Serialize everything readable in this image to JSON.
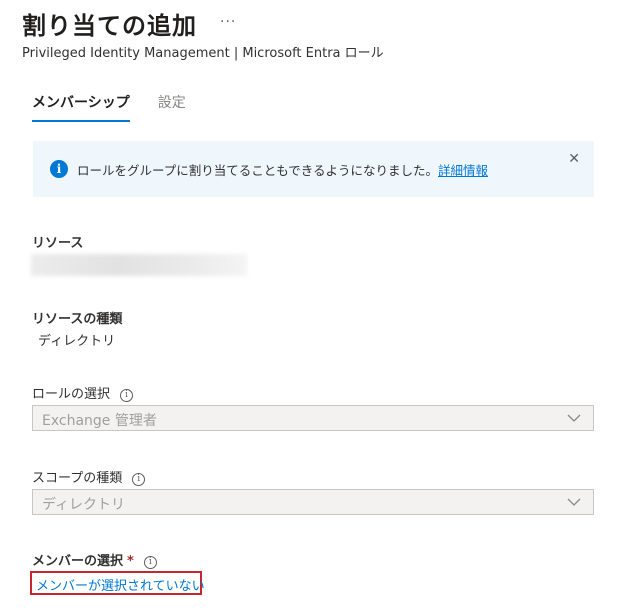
{
  "header": {
    "title": "割り当ての追加",
    "more_glyph": "···",
    "subtitle": "Privileged Identity Management | Microsoft Entra ロール"
  },
  "tabs": [
    {
      "label": "メンバーシップ",
      "active": true
    },
    {
      "label": "設定",
      "active": false
    }
  ],
  "banner": {
    "icon": "info-icon",
    "text": "ロールをグループに割り当てることもできるようになりました。",
    "link_text": "詳細情報",
    "close_glyph": "✕"
  },
  "resource": {
    "label": "リソース",
    "value_hidden": true
  },
  "resource_type": {
    "label": "リソースの種類",
    "value": "ディレクトリ"
  },
  "role_select": {
    "label": "ロールの選択",
    "value": "Exchange 管理者",
    "disabled": true
  },
  "scope_type": {
    "label": "スコープの種類",
    "value": "ディレクトリ",
    "disabled": true
  },
  "member_select": {
    "label": "メンバーの選択",
    "required_mark": "*",
    "link_text": "メンバーが選択されていない"
  },
  "info_glyph": "i",
  "colors": {
    "accent": "#0078d4",
    "banner_bg": "#eff6fc",
    "highlight_border": "#c4262e",
    "required": "#a4262c",
    "disabled_bg": "#f3f2f1",
    "disabled_text": "#a19f9d"
  }
}
